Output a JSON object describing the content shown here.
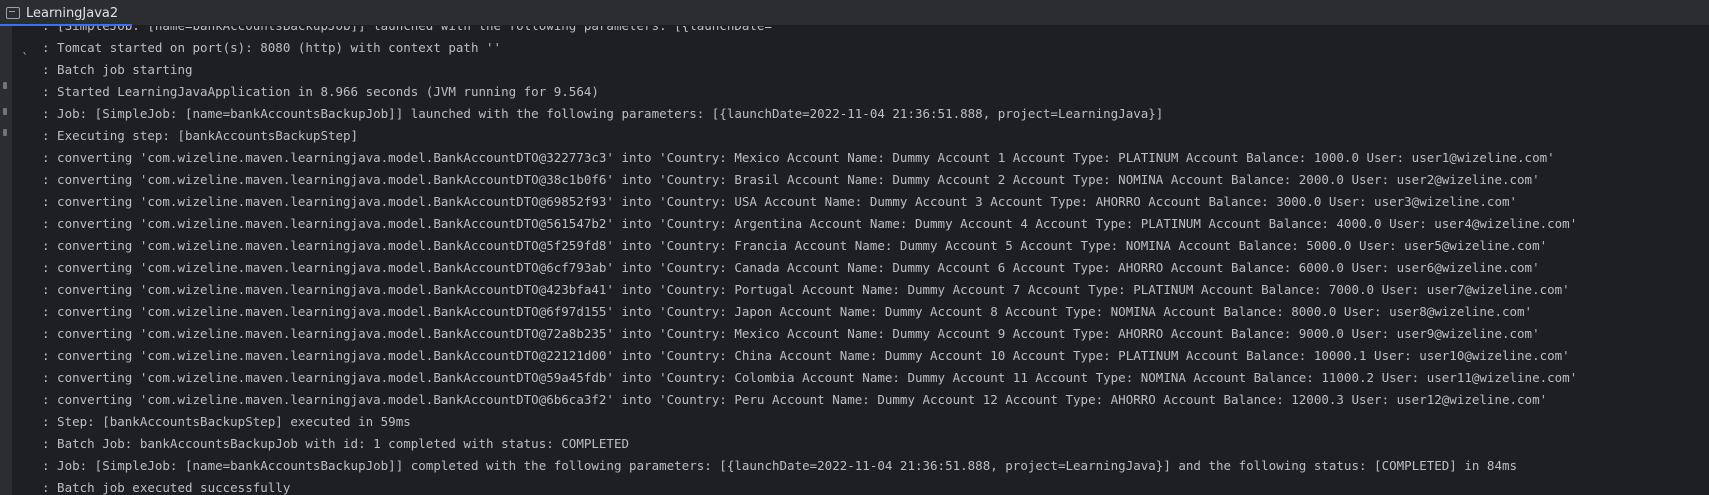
{
  "tab": {
    "title": "LearningJava2"
  },
  "console": {
    "lines": [
      ": [SimpleJob: [name=bankAccountsBackupJob]] launched with the following parameters: [{launchDate=",
      ": Tomcat started on port(s): 8080 (http) with context path ''",
      ": Batch job starting",
      ": Started LearningJavaApplication in 8.966 seconds (JVM running for 9.564)",
      ": Job: [SimpleJob: [name=bankAccountsBackupJob]] launched with the following parameters: [{launchDate=2022-11-04 21:36:51.888, project=LearningJava}]",
      ": Executing step: [bankAccountsBackupStep]",
      ": converting 'com.wizeline.maven.learningjava.model.BankAccountDTO@322773c3' into 'Country: Mexico Account Name: Dummy Account 1 Account Type: PLATINUM Account Balance: 1000.0 User: user1@wizeline.com'",
      ": converting 'com.wizeline.maven.learningjava.model.BankAccountDTO@38c1b0f6' into 'Country: Brasil Account Name: Dummy Account 2 Account Type: NOMINA Account Balance: 2000.0 User: user2@wizeline.com'",
      ": converting 'com.wizeline.maven.learningjava.model.BankAccountDTO@69852f93' into 'Country: USA Account Name: Dummy Account 3 Account Type: AHORRO Account Balance: 3000.0 User: user3@wizeline.com'",
      ": converting 'com.wizeline.maven.learningjava.model.BankAccountDTO@561547b2' into 'Country: Argentina Account Name: Dummy Account 4 Account Type: PLATINUM Account Balance: 4000.0 User: user4@wizeline.com'",
      ": converting 'com.wizeline.maven.learningjava.model.BankAccountDTO@5f259fd8' into 'Country: Francia Account Name: Dummy Account 5 Account Type: NOMINA Account Balance: 5000.0 User: user5@wizeline.com'",
      ": converting 'com.wizeline.maven.learningjava.model.BankAccountDTO@6cf793ab' into 'Country: Canada Account Name: Dummy Account 6 Account Type: AHORRO Account Balance: 6000.0 User: user6@wizeline.com'",
      ": converting 'com.wizeline.maven.learningjava.model.BankAccountDTO@423bfa41' into 'Country: Portugal Account Name: Dummy Account 7 Account Type: PLATINUM Account Balance: 7000.0 User: user7@wizeline.com'",
      ": converting 'com.wizeline.maven.learningjava.model.BankAccountDTO@6f97d155' into 'Country: Japon Account Name: Dummy Account 8 Account Type: NOMINA Account Balance: 8000.0 User: user8@wizeline.com'",
      ": converting 'com.wizeline.maven.learningjava.model.BankAccountDTO@72a8b235' into 'Country: Mexico Account Name: Dummy Account 9 Account Type: AHORRO Account Balance: 9000.0 User: user9@wizeline.com'",
      ": converting 'com.wizeline.maven.learningjava.model.BankAccountDTO@22121d00' into 'Country: China Account Name: Dummy Account 10 Account Type: PLATINUM Account Balance: 10000.1 User: user10@wizeline.com'",
      ": converting 'com.wizeline.maven.learningjava.model.BankAccountDTO@59a45fdb' into 'Country: Colombia Account Name: Dummy Account 11 Account Type: NOMINA Account Balance: 11000.2 User: user11@wizeline.com'",
      ": converting 'com.wizeline.maven.learningjava.model.BankAccountDTO@6b6ca3f2' into 'Country: Peru Account Name: Dummy Account 12 Account Type: AHORRO Account Balance: 12000.3 User: user12@wizeline.com'",
      ": Step: [bankAccountsBackupStep] executed in 59ms",
      ": Batch Job: bankAccountsBackupJob with id: 1 completed with status: COMPLETED",
      ": Job: [SimpleJob: [name=bankAccountsBackupJob]] completed with the following parameters: [{launchDate=2022-11-04 21:36:51.888, project=LearningJava}] and the following status: [COMPLETED] in 84ms",
      ": Batch job executed successfully"
    ]
  },
  "colors": {
    "background": "#1e1f22",
    "text": "#bcbec4",
    "tab_accent": "#3574f0"
  },
  "icons": {
    "tab_icon": "console-icon",
    "fold_icon": "fold-marker-icon"
  }
}
